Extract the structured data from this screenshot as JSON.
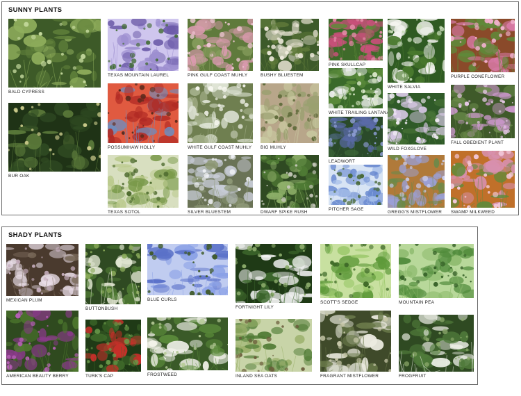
{
  "sunny": {
    "title": "SUNNY PLANTS",
    "plants": [
      {
        "label": "BALD CYPRESS",
        "colors": [
          "#5f7f3a",
          "#8fae5c",
          "#c7dba0",
          "#3d5a28"
        ]
      },
      {
        "label": "BUR OAK",
        "colors": [
          "#2f4a22",
          "#5b7a3a",
          "#c9c98a",
          "#1f3316"
        ]
      },
      {
        "label": "TEXAS MOUNTAIN LAUREL",
        "colors": [
          "#6b5aa8",
          "#9d8fd0",
          "#3f6b2f",
          "#cfc6ee"
        ]
      },
      {
        "label": "POSSUMHAW HOLLY",
        "colors": [
          "#b02a24",
          "#6a8fc2",
          "#5a2a1c",
          "#e05a40"
        ]
      },
      {
        "label": "TEXAS SOTOL",
        "colors": [
          "#7a9a4a",
          "#b9c98a",
          "#4d6a2e",
          "#d8dfc0"
        ]
      },
      {
        "label": "PINK GULF COAST MUHLY",
        "colors": [
          "#d99aae",
          "#8aa060",
          "#f0c8d6",
          "#5f7a3c"
        ]
      },
      {
        "label": "WHITE GULF COAST MUHLY",
        "colors": [
          "#dfe4d6",
          "#a4b08a",
          "#f7f7f0",
          "#6f7f50"
        ]
      },
      {
        "label": "SILVER BLUESTEM",
        "colors": [
          "#c9cdd8",
          "#8f9a78",
          "#eef0f4",
          "#6a7356"
        ]
      },
      {
        "label": "BUSHY BLUESTEM",
        "colors": [
          "#d8d6c4",
          "#5f7a3a",
          "#eeeadc",
          "#3d5a2a"
        ]
      },
      {
        "label": "BIG MUHLY",
        "colors": [
          "#9aa070",
          "#c8c8a0",
          "#5f6a3a",
          "#b8a68a"
        ]
      },
      {
        "label": "DWARF SPIKE RUSH",
        "colors": [
          "#4f7a34",
          "#8fb06a",
          "#c4c6b8",
          "#2f4a22"
        ]
      },
      {
        "label": "PINK SKULLCAP",
        "colors": [
          "#c8507a",
          "#5f8a3a",
          "#e68aa8",
          "#3f6a2a"
        ]
      },
      {
        "label": "WHITE TRAILING LANTANA",
        "colors": [
          "#f2f2f2",
          "#5a8a3a",
          "#d8e6c8",
          "#3a6a2a"
        ]
      },
      {
        "label": "LEADWORT",
        "colors": [
          "#5a6aa8",
          "#3f6a3a",
          "#8a9ad0",
          "#2a4a2a"
        ]
      },
      {
        "label": "PITCHER SAGE",
        "colors": [
          "#6a8ad0",
          "#a8c0ea",
          "#4a6a3a",
          "#d8e4f4"
        ]
      },
      {
        "label": "WHITE SALVIA",
        "colors": [
          "#f4f4f0",
          "#4a7a2e",
          "#c8dcb8",
          "#2f5a22"
        ]
      },
      {
        "label": "WILD FOXGLOVE",
        "colors": [
          "#d8c8e6",
          "#4f7a3a",
          "#f2ecf6",
          "#2f5a28"
        ]
      },
      {
        "label": "GREGG'S MISTFLOWER",
        "colors": [
          "#9aa0d8",
          "#6a8a4a",
          "#c8ccee",
          "#b07a3a"
        ]
      },
      {
        "label": "PURPLE CONEFLOWER",
        "colors": [
          "#d87aa8",
          "#5f8a3a",
          "#f0b0cc",
          "#8a4a2a"
        ]
      },
      {
        "label": "FALL OBEDIENT PLANT",
        "colors": [
          "#c896c8",
          "#6a8a4a",
          "#e6c8e6",
          "#3f5a2a"
        ]
      },
      {
        "label": "SWAMP MILKWEED",
        "colors": [
          "#d890b0",
          "#5f8a3a",
          "#f2c8da",
          "#c0702a"
        ]
      }
    ]
  },
  "shady": {
    "title": "SHADY PLANTS",
    "plants": [
      {
        "label": "MEXICAN PLUM",
        "colors": [
          "#e8dce6",
          "#7a6a5a",
          "#c8b0c0",
          "#4a3a2e"
        ]
      },
      {
        "label": "AMERICAN BEAUTY BERRY",
        "colors": [
          "#8a3a8a",
          "#4f7a2e",
          "#b860b8",
          "#2f4a1f"
        ]
      },
      {
        "label": "BUTTONBUSH",
        "colors": [
          "#4f7a34",
          "#e8ecd8",
          "#8aaa5a",
          "#2f4a22"
        ]
      },
      {
        "label": "TURK'S CAP",
        "colors": [
          "#c8302a",
          "#3f6a2a",
          "#6a9a4a",
          "#1f3a16"
        ]
      },
      {
        "label": "BLUE CURLS",
        "colors": [
          "#5a70c8",
          "#8aa0e6",
          "#3f5a2a",
          "#c0ccf0"
        ]
      },
      {
        "label": "FROSTWEED",
        "colors": [
          "#f2f2ea",
          "#5a8a3a",
          "#b8cc9a",
          "#3a5a28"
        ]
      },
      {
        "label": "FORTNIGHT LILY",
        "colors": [
          "#f4f4f4",
          "#3f6a2e",
          "#8aaa6a",
          "#1f3a16"
        ]
      },
      {
        "label": "INLAND SEA OATS",
        "colors": [
          "#4f7a34",
          "#9ab06a",
          "#6a5a3a",
          "#c8d4a8"
        ]
      },
      {
        "label": "SCOTT'S SEDGE",
        "colors": [
          "#5f9a3a",
          "#9ac86a",
          "#3f6a28",
          "#c8e0a0"
        ]
      },
      {
        "label": "FRAGRANT MISTFLOWER",
        "colors": [
          "#ecebe0",
          "#6a7a4a",
          "#c8c8aa",
          "#3f4a2a"
        ]
      },
      {
        "label": "MOUNTAIN PEA",
        "colors": [
          "#4f8a3a",
          "#8ab86a",
          "#2f5a22",
          "#b8d89a"
        ]
      },
      {
        "label": "FROGFRUIT",
        "colors": [
          "#4f7a3a",
          "#eef0e8",
          "#8aa86a",
          "#2f4a22"
        ]
      }
    ]
  }
}
